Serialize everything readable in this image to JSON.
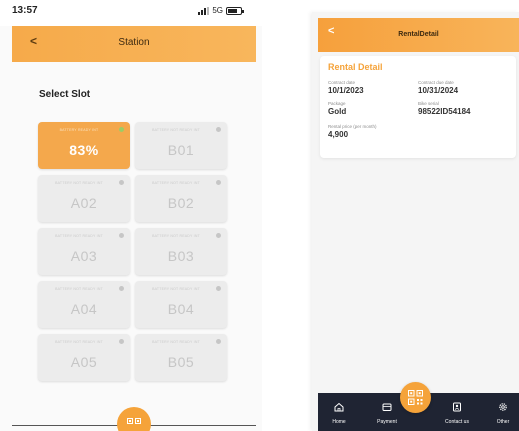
{
  "left_screen": {
    "status_bar": {
      "time": "13:57",
      "network": "5G"
    },
    "header": {
      "back_label": "<",
      "title": "Station"
    },
    "section_title": "Select Slot",
    "slot_status_text": {
      "ready": "BATTERY READY INT",
      "not_ready": "BATTERY NOT READY INT"
    },
    "slots": [
      {
        "label": "83%",
        "status": "ready",
        "active": true
      },
      {
        "label": "B01",
        "status": "not_ready",
        "active": false
      },
      {
        "label": "A02",
        "status": "not_ready",
        "active": false
      },
      {
        "label": "B02",
        "status": "not_ready",
        "active": false
      },
      {
        "label": "A03",
        "status": "not_ready",
        "active": false
      },
      {
        "label": "B03",
        "status": "not_ready",
        "active": false
      },
      {
        "label": "A04",
        "status": "not_ready",
        "active": false
      },
      {
        "label": "B04",
        "status": "not_ready",
        "active": false
      },
      {
        "label": "A05",
        "status": "not_ready",
        "active": false
      },
      {
        "label": "B05",
        "status": "not_ready",
        "active": false
      }
    ]
  },
  "right_screen": {
    "header": {
      "back_label": "<",
      "title": "RentalDetail"
    },
    "card": {
      "title": "Rental Detail",
      "contract_date_label": "Contract date",
      "contract_date": "10/1/2023",
      "contract_due_label": "Contract due date",
      "contract_due": "10/31/2024",
      "package_label": "Package",
      "package": "Gold",
      "bike_serial_label": "Bike serial",
      "bike_serial": "98522ID54184",
      "rental_price_label": "Rental price (per month)",
      "rental_price": "4,900"
    },
    "nav": [
      {
        "label": "Home",
        "icon": "home-icon"
      },
      {
        "label": "Payment",
        "icon": "wallet-icon"
      },
      {
        "label": "Contact us",
        "icon": "contact-icon"
      },
      {
        "label": "Other",
        "icon": "gear-icon"
      }
    ]
  },
  "colors": {
    "accent": "#f5a33a",
    "nav_background": "#1f2433",
    "active_slot": "#f4a84c",
    "inactive_slot": "#ececec"
  }
}
